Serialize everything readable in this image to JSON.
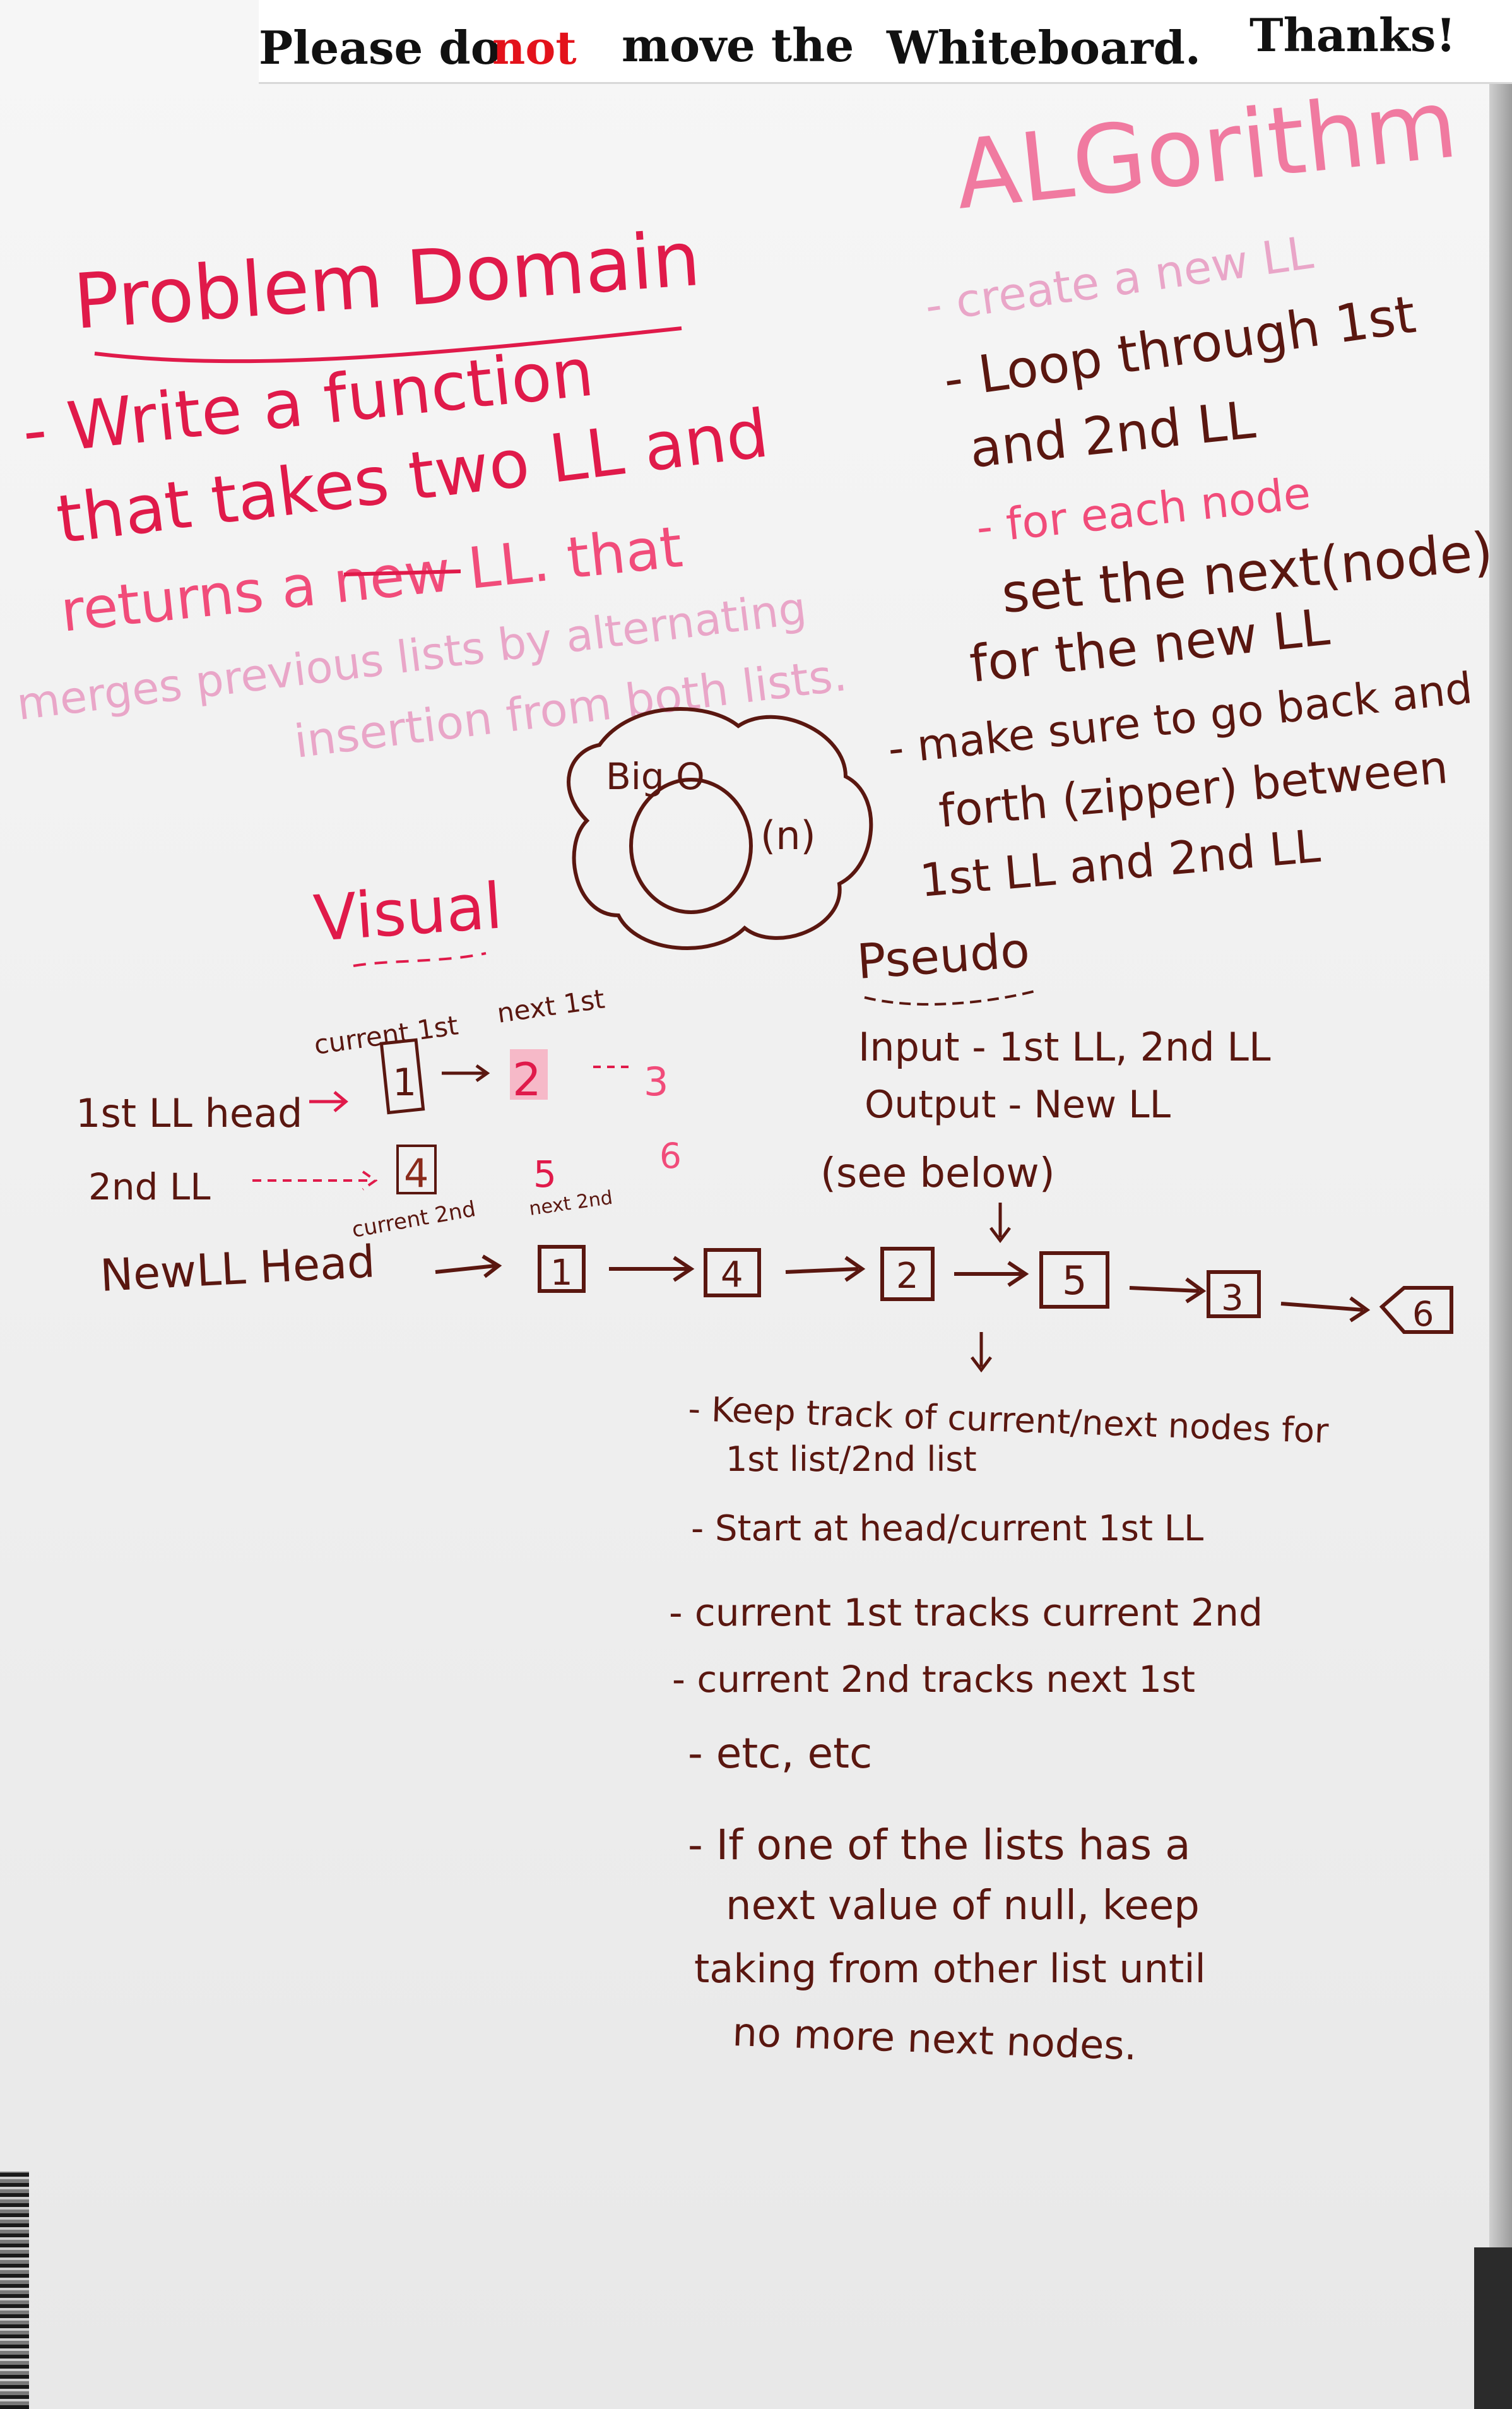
{
  "sign": {
    "please_do": "Please do",
    "not": "not",
    "move_the": "move the",
    "whiteboard": "Whiteboard.",
    "thanks": "Thanks!"
  },
  "problem_domain": {
    "heading": "Problem Domain",
    "lines": [
      "- Write a function",
      "that takes two LL and",
      "returns a new LL. that",
      "merges previous lists by alternating",
      "insertion from both lists."
    ]
  },
  "algorithm": {
    "heading": "ALGorithm",
    "lines": [
      "- create a new LL",
      "- Loop through 1st",
      "and 2nd LL",
      "- for each node",
      "set the next(node)",
      "for the new LL",
      "- make sure to go back and",
      "forth (zipper) between",
      "1st LL and 2nd LL"
    ]
  },
  "big_o": {
    "label": "Big O",
    "value": "(n)"
  },
  "visual": {
    "heading": "Visual",
    "current_1st_label": "current 1st",
    "next_1st_label": "next 1st",
    "current_2nd_label": "current 2nd",
    "next_2nd_label": "next 2nd",
    "list1_label": "1st LL head",
    "list2_label": "2nd LL",
    "list1_values": [
      "1",
      "2",
      "3"
    ],
    "list2_values": [
      "4",
      "5",
      "6"
    ],
    "newll_label": "NewLL Head",
    "newll_values": [
      "1",
      "4",
      "2",
      "5",
      "3",
      "6"
    ]
  },
  "pseudo": {
    "heading": "Pseudo",
    "input": "Input - 1st LL, 2nd LL",
    "output": "Output - New LL",
    "see_below": "(see below)",
    "steps": [
      "- Keep track of current/next nodes for",
      "1st list/2nd list",
      "- Start at head/current 1st LL",
      "- current 1st tracks current 2nd",
      "- current 2nd tracks next 1st",
      "- etc, etc",
      "- If one of the lists has a",
      "next value of null, keep",
      "taking from other list until",
      "no more next nodes."
    ]
  },
  "colors": {
    "marker_red": "#e01a4a",
    "marker_brown": "#5a1710",
    "board": "#f2f2f0"
  }
}
